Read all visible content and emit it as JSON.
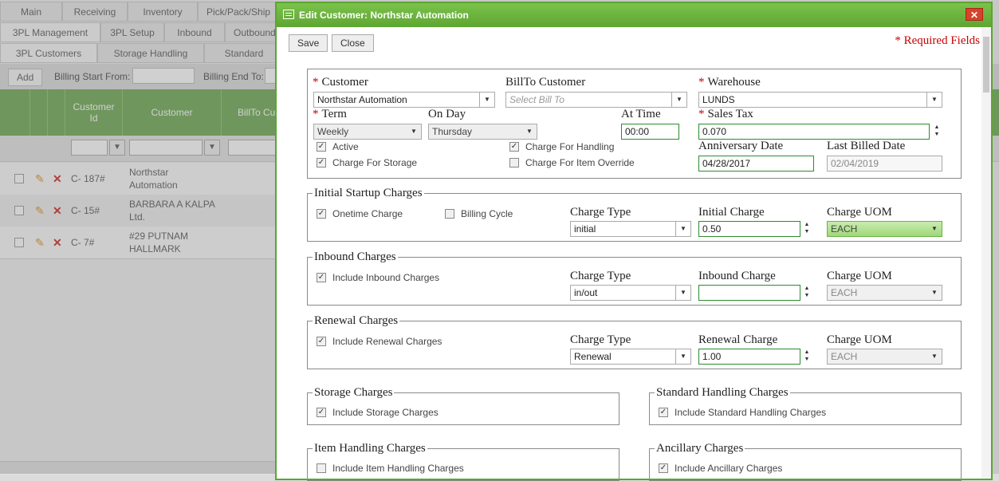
{
  "app": {
    "main_tabs": [
      "Main",
      "Receiving",
      "Inventory",
      "Pick/Pack/Ship"
    ],
    "sub_tabs": [
      "3PL Management",
      "3PL Setup",
      "Inbound",
      "Outbound"
    ],
    "sub_sub_tabs": [
      "3PL Customers",
      "Storage Handling",
      "Standard Hand"
    ],
    "toolbar": {
      "add_label": "Add",
      "billing_start_label": "Billing Start From:",
      "billing_end_label": "Billing End To:"
    },
    "grid": {
      "headers": [
        "Customer Id",
        "Customer",
        "BillTo Cu"
      ],
      "rows": [
        {
          "id": "C- 187#",
          "customer": "Northstar Automation"
        },
        {
          "id": "C- 15#",
          "customer": "BARBARA A KALPA Ltd."
        },
        {
          "id": "C- 7#",
          "customer": "#29 PUTNAM HALLMARK"
        }
      ]
    }
  },
  "modal": {
    "title": "Edit Customer: Northstar Automation",
    "close_x": "✕",
    "save_label": "Save",
    "close_label": "Close",
    "required_note": "* Required Fields",
    "general": {
      "customer_label": "Customer",
      "customer_value": "Northstar Automation",
      "billto_label": "BillTo Customer",
      "billto_placeholder": "Select Bill To",
      "warehouse_label": "Warehouse",
      "warehouse_value": "LUNDS",
      "term_label": "Term",
      "term_value": "Weekly",
      "onday_label": "On Day",
      "onday_value": "Thursday",
      "attime_label": "At Time",
      "attime_value": "00:00",
      "salestax_label": "Sales Tax",
      "salestax_value": "0.070",
      "active_label": "Active",
      "charge_storage_label": "Charge For Storage",
      "charge_handling_label": "Charge For Handling",
      "charge_item_override_label": "Charge For Item Override",
      "anniversary_label": "Anniversary Date",
      "anniversary_value": "04/28/2017",
      "last_billed_label": "Last Billed Date",
      "last_billed_value": "02/04/2019",
      "checks": {
        "active": true,
        "charge_storage": true,
        "charge_handling": true,
        "charge_item_override": false
      }
    },
    "initial": {
      "legend": "Initial Startup Charges",
      "onetime_label": "Onetime Charge",
      "billing_cycle_label": "Billing Cycle",
      "charge_type_label": "Charge Type",
      "charge_type_value": "initial",
      "amount_label": "Initial Charge",
      "amount_value": "0.50",
      "uom_label": "Charge UOM",
      "uom_value": "EACH",
      "checks": {
        "onetime": true,
        "billing_cycle": false
      }
    },
    "inbound": {
      "legend": "Inbound Charges",
      "include_label": "Include Inbound Charges",
      "charge_type_label": "Charge Type",
      "charge_type_value": "in/out",
      "amount_label": "Inbound Charge",
      "amount_value": "",
      "uom_label": "Charge UOM",
      "uom_value": "EACH",
      "checks": {
        "include": true
      }
    },
    "renewal": {
      "legend": "Renewal Charges",
      "include_label": "Include Renewal Charges",
      "charge_type_label": "Charge Type",
      "charge_type_value": "Renewal",
      "amount_label": "Renewal Charge",
      "amount_value": "1.00",
      "uom_label": "Charge UOM",
      "uom_value": "EACH",
      "checks": {
        "include": true
      }
    },
    "storage": {
      "legend": "Storage Charges",
      "include_label": "Include Storage Charges",
      "checked": true
    },
    "standard_handling": {
      "legend": "Standard Handling Charges",
      "include_label": "Include Standard Handling Charges",
      "checked": true
    },
    "item_handling": {
      "legend": "Item Handling Charges",
      "include_label": "Include Item Handling Charges",
      "checked": false
    },
    "ancillary": {
      "legend": "Ancillary Charges",
      "include_label": "Include Ancillary Charges",
      "checked": true
    }
  },
  "colors": {
    "accent": "#6ab23e",
    "required": "#cc0000",
    "grid_header": "#6aa84f",
    "close_button": "#d9412b"
  }
}
